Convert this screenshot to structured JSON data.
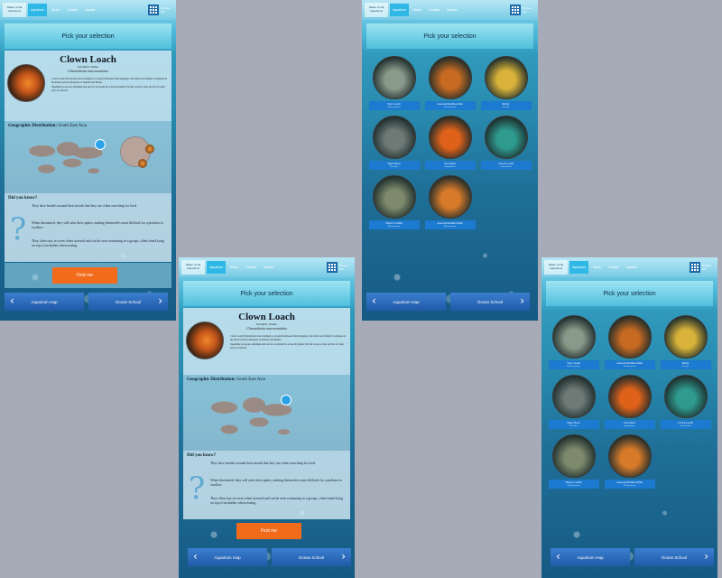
{
  "nav": {
    "logo": "Maker\nCoral\nAquariums",
    "tabs": [
      "Aquarium",
      "Shark",
      "Coastal",
      "Aquatic"
    ],
    "grid_label": "Browse\nfish"
  },
  "header": "Pick your selection",
  "detail": {
    "title": "Clown Loach",
    "sci_label": "Scientific Name:",
    "sci_name": "Chromobotia macracanthus",
    "desc1": "Clown Loach (Chromobotia macracanthus) is a tropical freshwater fish belonging to the botiid loach family. It originates in the inland waters in Indonesia on Sumatra and Borneo.",
    "desc2": "Depending on species, minimum tank size for one should be at least 40 gallons; the fish can grow large and live for many years in captivity.",
    "geo_label": "Geographic Distribution:",
    "geo_value": "South East Asia",
    "did_label": "Did you know?",
    "facts": [
      "They have barbels around their mouth that they use when searching for food.",
      "When threatened, they will raise their spines, making themselves more difficult for a predator to swallow.",
      "They often stay in caves when stressed and can be seen swimming in a groups, often found lying on top of eachother when resting."
    ],
    "find_btn": "Find me"
  },
  "bottom": {
    "left": "Aquarium map",
    "right": "Ocean School"
  },
  "fish": [
    {
      "name": "Yoyo loach",
      "sub": "Botia almorhae",
      "color": "#8a9a8a"
    },
    {
      "name": "Assorted Rainbowfish",
      "sub": "Melanotaenia",
      "color": "#c76a22"
    },
    {
      "name": "Molly",
      "sub": "Poecilia",
      "color": "#d8b23a"
    },
    {
      "name": "Tiger Pleco",
      "sub": "Peckoltia",
      "color": "#6e7a76"
    },
    {
      "name": "Swordtail",
      "sub": "Xiphophorus",
      "color": "#e0621a"
    },
    {
      "name": "Clown Loach",
      "sub": "Chromobotia",
      "color": "#2f9a8e"
    },
    {
      "name": "Hoplo Catfish",
      "sub": "Hoplosternum",
      "color": "#7d8a6c"
    },
    {
      "name": "Assorted Rainbowfish",
      "sub": "Melanotaenia",
      "color": "#d77a2a"
    }
  ]
}
